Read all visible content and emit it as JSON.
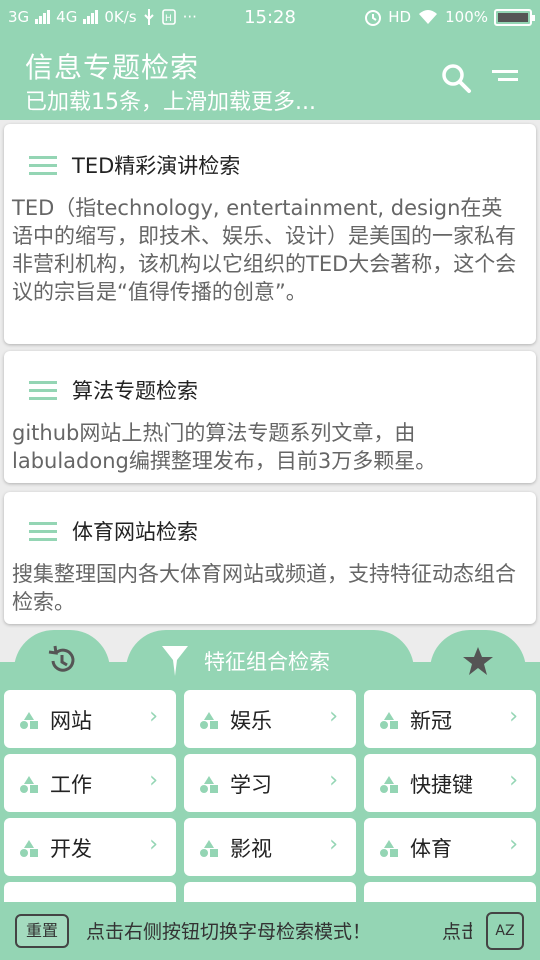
{
  "statusbar": {
    "left_net1": "3G",
    "left_net2": "4G",
    "speed": "0K/s",
    "more": "···",
    "time": "15:28",
    "hd": "HD",
    "battery": "100%"
  },
  "header": {
    "title": "信息专题检索",
    "subtitle": "已加载15条，上滑加载更多..."
  },
  "cards": [
    {
      "title": "TED精彩演讲检索",
      "desc": "TED（指technology, entertainment, design在英语中的缩写，即技术、娱乐、设计）是美国的一家私有非营利机构，该机构以它组织的TED大会著称，这个会议的宗旨是“值得传播的创意”。"
    },
    {
      "title": "算法专题检索",
      "desc": "github网站上热门的算法专题系列文章，由labuladong编撰整理发布，目前3万多颗星。"
    },
    {
      "title": "体育网站检索",
      "desc": "搜集整理国内各大体育网站或频道，支持特征动态组合检索。"
    }
  ],
  "category_panel": {
    "main_tab_label": "特征组合检索",
    "items": [
      "网站",
      "娱乐",
      "新冠",
      "工作",
      "学习",
      "快捷键",
      "开发",
      "影视",
      "体育"
    ],
    "arrow": "›"
  },
  "bottom_bar": {
    "reset_label": "重置",
    "marquee_text": "点击右侧按钮切换字母检索模式！",
    "marquee_tail": "点击",
    "az_label": "AZ"
  },
  "colors": {
    "accent": "#94d5b4",
    "card_bg": "#ffffff",
    "text_dark": "#222222",
    "text_muted": "#666666"
  },
  "icons": {
    "search": "search-icon",
    "menu": "menu-icon",
    "history": "history-icon",
    "star": "star-icon",
    "filter": "funnel-icon",
    "category": "shapes-icon"
  }
}
